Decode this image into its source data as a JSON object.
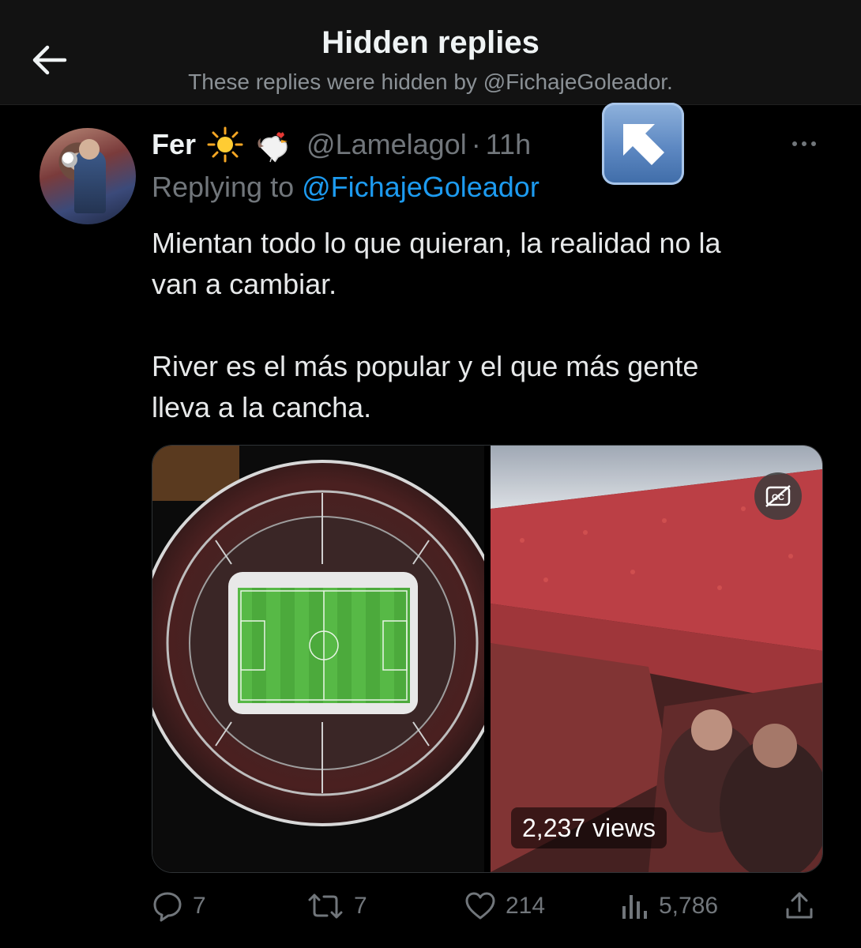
{
  "header": {
    "title": "Hidden replies",
    "subtitle": "These replies were hidden by @FichajeGoleador.",
    "back_icon": "arrow-left-icon"
  },
  "tweet": {
    "display_name": "Fer",
    "name_emojis": [
      "sun-emoji",
      "rooster-emoji"
    ],
    "handle": "@Lamelagol",
    "separator": "·",
    "time": "11h",
    "reply_prefix": "Replying to",
    "reply_to": "@FichajeGoleador",
    "text": "Mientan todo lo que quieran, la realidad no la\nvan a cambiar.\n\nRiver es el más popular y el que más gente\nlleva a la cancha.",
    "media": {
      "left": "stadium-aerial-photo",
      "right": "crowd-video",
      "views": "2,237 views"
    },
    "actions": {
      "replies": "7",
      "reposts": "7",
      "likes": "214",
      "views": "5,786"
    }
  },
  "colors": {
    "background": "#000000",
    "topbar": "#121212",
    "link": "#1d9bf0",
    "muted": "#71767b",
    "text": "#e7e9ea"
  }
}
